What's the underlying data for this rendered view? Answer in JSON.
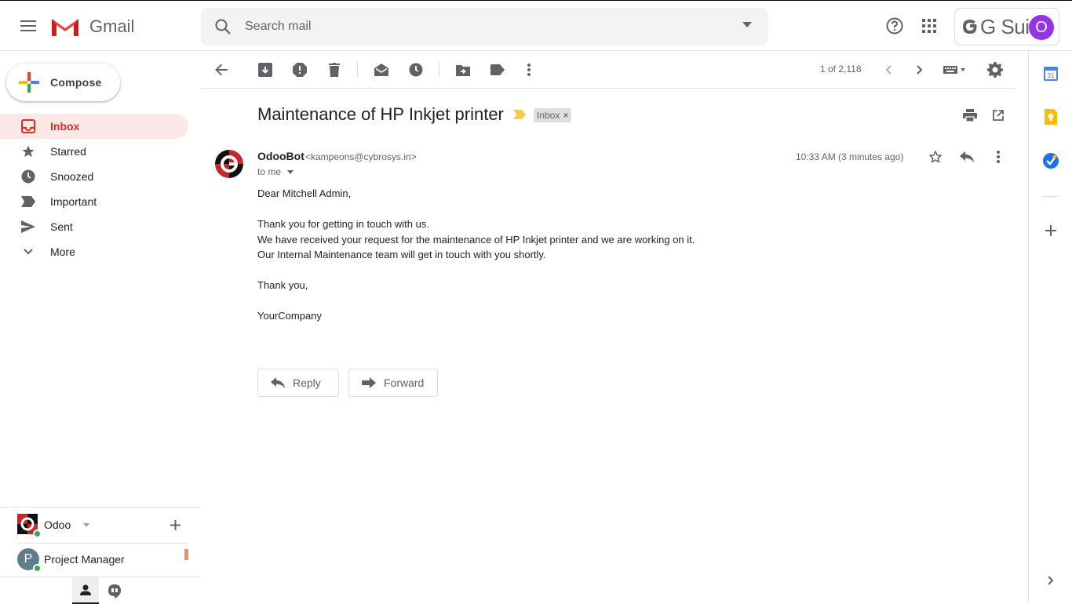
{
  "app": {
    "name": "Gmail"
  },
  "search": {
    "placeholder": "Search mail"
  },
  "gsuite": {
    "label": "G Suite",
    "avatar_letter": "O",
    "avatar_color": "#9334e6"
  },
  "compose": {
    "label": "Compose"
  },
  "nav": [
    {
      "label": "Inbox",
      "icon": "inbox-icon",
      "active": true
    },
    {
      "label": "Starred",
      "icon": "star-icon"
    },
    {
      "label": "Snoozed",
      "icon": "clock-icon"
    },
    {
      "label": "Important",
      "icon": "important-icon"
    },
    {
      "label": "Sent",
      "icon": "send-icon"
    },
    {
      "label": "More",
      "icon": "chevron-down-icon"
    }
  ],
  "hangouts": {
    "account": "Odoo",
    "contact": {
      "name": "Project Manager",
      "initial": "P"
    }
  },
  "toolbar": {
    "pager": "1 of 2,118"
  },
  "message": {
    "subject": "Maintenance of HP Inkjet printer",
    "label": "Inbox",
    "sender_name": "OdooBot",
    "sender_email": "<kampeons@cybrosys.in>",
    "to": "to me",
    "time": "10:33 AM (3 minutes ago)",
    "body": [
      "Dear Mitchell Admin,",
      "Thank you for getting in touch with us.",
      "We have received your request for the maintenance of HP Inkjet printer and we are working on it.",
      "Our Internal Maintenance team will get in touch with you shortly.",
      "Thank you,",
      "YourCompany"
    ]
  },
  "actions": {
    "reply": "Reply",
    "forward": "Forward"
  },
  "colors": {
    "accent": "#d93025",
    "active_bg": "#fce8e6",
    "online": "#34a853"
  }
}
